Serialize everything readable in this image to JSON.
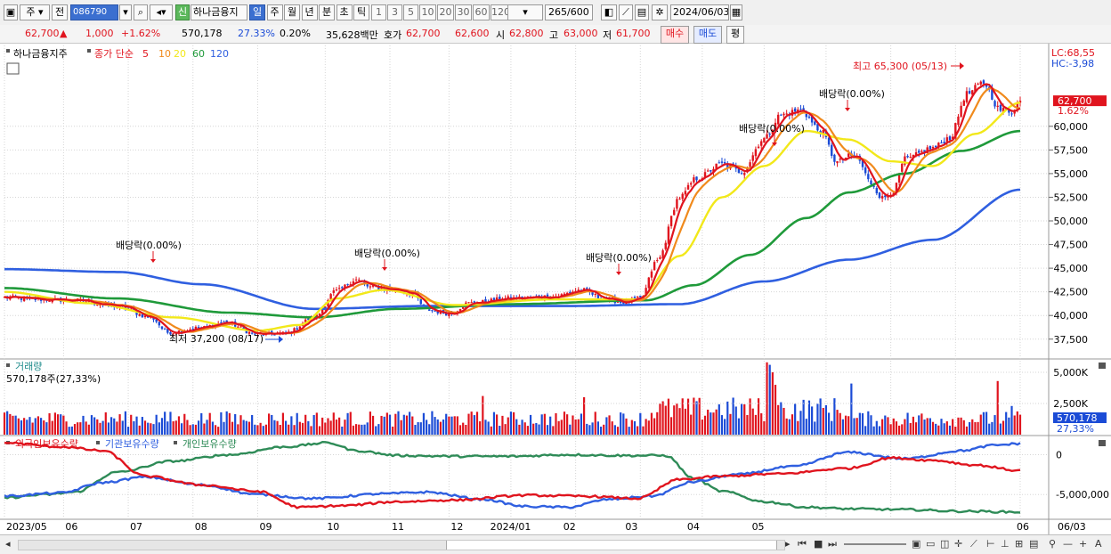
{
  "toolbar": {
    "period_mode": "주",
    "prev_label": "전",
    "code": "086790",
    "new_badge": "신",
    "stock_name": "하나금융지",
    "periods": [
      "일",
      "주",
      "월",
      "년",
      "분",
      "초",
      "틱"
    ],
    "selected_period": "일",
    "intervals": [
      "1",
      "3",
      "5",
      "10",
      "20",
      "30",
      "60",
      "120"
    ],
    "count": "265",
    "count_total": "/600",
    "date": "2024/06/03"
  },
  "quote": {
    "price": "62,700",
    "arrow": "▲",
    "change": "1,000",
    "change_pct": "+1.62%",
    "volume": "570,178",
    "volume_ratio": "27.33%",
    "turnover_pct": "0.20%",
    "amount": "35,628백만",
    "bid_label": "호가",
    "ask_price": "62,700",
    "bid_price": "62,600",
    "open_label": "시",
    "open": "62,800",
    "high_label": "고",
    "high": "63,000",
    "low_label": "저",
    "low": "61,700",
    "buy_label": "매수",
    "sell_label": "매도",
    "avg_label": "평"
  },
  "colors": {
    "up": "#e0141e",
    "down": "#1b4bd6",
    "ma5": "#e0141e",
    "ma10": "#f08a1c",
    "ma20": "#f2e81a",
    "ma60": "#1f9a3a",
    "ma120": "#2f5fe0",
    "foreign": "#e0141e",
    "institution": "#2f5fe0",
    "individual": "#2e8b57"
  },
  "chart_data": [
    {
      "type": "candlestick",
      "title": "하나금융지주",
      "legend": [
        "종가 단순",
        "5",
        "10",
        "20",
        "60",
        "120"
      ],
      "ylim": [
        35500,
        68550
      ],
      "y_ticks": [
        "62,700",
        "60,000",
        "57,500",
        "55,000",
        "52,500",
        "50,000",
        "47,500",
        "45,000",
        "42,500",
        "40,000",
        "37,500"
      ],
      "x_ticks": [
        "2023/05",
        "06",
        "07",
        "08",
        "09",
        "10",
        "11",
        "12",
        "2024/01",
        "02",
        "03",
        "04",
        "05",
        "06",
        "06/03"
      ],
      "lc": "LC:68,55",
      "hc": "HC:-3,98",
      "last_price": "62,700",
      "last_pct": "1.62%",
      "price_anchors": [
        [
          0,
          41900
        ],
        [
          12,
          41700
        ],
        [
          25,
          41600
        ],
        [
          40,
          41000
        ],
        [
          52,
          39800
        ],
        [
          58,
          38200
        ],
        [
          70,
          38700
        ],
        [
          78,
          39300
        ],
        [
          90,
          38000
        ],
        [
          100,
          38100
        ],
        [
          110,
          39800
        ],
        [
          118,
          42600
        ],
        [
          125,
          43800
        ],
        [
          130,
          43000
        ],
        [
          140,
          42700
        ],
        [
          145,
          42300
        ],
        [
          150,
          40600
        ],
        [
          158,
          40200
        ],
        [
          165,
          41300
        ],
        [
          180,
          41800
        ],
        [
          195,
          42000
        ],
        [
          205,
          42700
        ],
        [
          213,
          41800
        ],
        [
          220,
          41400
        ],
        [
          226,
          41800
        ],
        [
          232,
          45800
        ],
        [
          240,
          52500
        ],
        [
          246,
          54500
        ],
        [
          255,
          56000
        ],
        [
          262,
          55200
        ],
        [
          270,
          58700
        ],
        [
          276,
          61200
        ],
        [
          283,
          61700
        ],
        [
          290,
          59500
        ],
        [
          296,
          56200
        ],
        [
          300,
          56800
        ],
        [
          303,
          56600
        ],
        [
          308,
          54000
        ],
        [
          312,
          52400
        ],
        [
          316,
          53200
        ],
        [
          320,
          56500
        ],
        [
          330,
          57700
        ],
        [
          336,
          58800
        ],
        [
          342,
          63400
        ],
        [
          348,
          64600
        ],
        [
          354,
          61700
        ],
        [
          358,
          61600
        ],
        [
          361,
          62700
        ]
      ],
      "ma_anchors": {
        "ma20": [
          [
            0,
            42500
          ],
          [
            30,
            41300
          ],
          [
            60,
            39800
          ],
          [
            90,
            38400
          ],
          [
            105,
            39000
          ],
          [
            118,
            41800
          ],
          [
            135,
            42700
          ],
          [
            160,
            41100
          ],
          [
            195,
            41700
          ],
          [
            225,
            41700
          ],
          [
            240,
            46300
          ],
          [
            255,
            52500
          ],
          [
            270,
            55800
          ],
          [
            285,
            59500
          ],
          [
            300,
            58600
          ],
          [
            315,
            56300
          ],
          [
            330,
            55800
          ],
          [
            345,
            59200
          ],
          [
            361,
            62500
          ]
        ],
        "ma60": [
          [
            0,
            42900
          ],
          [
            40,
            41800
          ],
          [
            80,
            40300
          ],
          [
            110,
            39800
          ],
          [
            140,
            40700
          ],
          [
            180,
            41200
          ],
          [
            228,
            41600
          ],
          [
            245,
            43200
          ],
          [
            265,
            46400
          ],
          [
            285,
            50300
          ],
          [
            300,
            53000
          ],
          [
            320,
            55000
          ],
          [
            340,
            57400
          ],
          [
            361,
            59500
          ]
        ],
        "ma120": [
          [
            0,
            44900
          ],
          [
            40,
            44600
          ],
          [
            70,
            43300
          ],
          [
            110,
            40700
          ],
          [
            150,
            41000
          ],
          [
            200,
            41000
          ],
          [
            240,
            41200
          ],
          [
            270,
            43600
          ],
          [
            300,
            45900
          ],
          [
            330,
            48000
          ],
          [
            361,
            53300
          ]
        ]
      },
      "annotations": [
        {
          "text": "배당락(0.00%)",
          "type": "dividend"
        },
        {
          "text": "최저 37,200 (08/17)",
          "type": "low"
        },
        {
          "text": "배당락(0.00%)",
          "type": "dividend"
        },
        {
          "text": "배당락(0.00%)",
          "type": "dividend"
        },
        {
          "text": "배당락(0.00%)",
          "type": "dividend"
        },
        {
          "text": "배당락(0.00%)",
          "type": "dividend"
        },
        {
          "text": "최고 65,300 (05/13)",
          "type": "high"
        }
      ]
    },
    {
      "type": "bar",
      "title": "거래량",
      "current": "570,178주(27,33%)",
      "y_ticks": [
        "5,000K",
        "2,500K"
      ],
      "last_value": "570,178",
      "last_pct": "27,33%",
      "ylim": [
        0,
        6000000
      ],
      "baseline": 1400000,
      "spikes": [
        [
          170,
          3100000
        ],
        [
          206,
          3000000
        ],
        [
          271,
          5800000
        ],
        [
          272,
          5600000
        ],
        [
          273,
          5000000
        ],
        [
          274,
          4000000
        ],
        [
          301,
          4100000
        ],
        [
          353,
          4300000
        ],
        [
          358,
          2300000
        ]
      ]
    },
    {
      "type": "line",
      "series_labels": [
        "외국인보유수량",
        "기관보유수량",
        "개인보유수량"
      ],
      "y_ticks": [
        "0",
        "-5,000,000"
      ],
      "foreign": [
        [
          0,
          1500000
        ],
        [
          20,
          1000000
        ],
        [
          35,
          500000
        ],
        [
          50,
          -2700000
        ],
        [
          70,
          -3800000
        ],
        [
          90,
          -4600000
        ],
        [
          105,
          -6600000
        ],
        [
          120,
          -6400000
        ],
        [
          140,
          -5900000
        ],
        [
          160,
          -5700000
        ],
        [
          185,
          -5100000
        ],
        [
          205,
          -5200000
        ],
        [
          225,
          -5500000
        ],
        [
          240,
          -3100000
        ],
        [
          255,
          -2700000
        ],
        [
          275,
          -2400000
        ],
        [
          300,
          -1700000
        ],
        [
          315,
          -400000
        ],
        [
          330,
          -700000
        ],
        [
          345,
          -1300000
        ],
        [
          361,
          -2000000
        ]
      ],
      "institution": [
        [
          0,
          -5200000
        ],
        [
          20,
          -4800000
        ],
        [
          35,
          -3500000
        ],
        [
          50,
          -2800000
        ],
        [
          70,
          -3800000
        ],
        [
          90,
          -5000000
        ],
        [
          110,
          -5500000
        ],
        [
          135,
          -4900000
        ],
        [
          150,
          -4700000
        ],
        [
          170,
          -5600000
        ],
        [
          185,
          -6500000
        ],
        [
          200,
          -6600000
        ],
        [
          215,
          -5600000
        ],
        [
          230,
          -5200000
        ],
        [
          245,
          -3400000
        ],
        [
          260,
          -2500000
        ],
        [
          280,
          -1500000
        ],
        [
          300,
          300000
        ],
        [
          320,
          -500000
        ],
        [
          340,
          500000
        ],
        [
          352,
          1200000
        ],
        [
          361,
          1400000
        ]
      ],
      "individual": [
        [
          0,
          -5400000
        ],
        [
          15,
          -5000000
        ],
        [
          25,
          -4700000
        ],
        [
          40,
          -2200000
        ],
        [
          60,
          -800000
        ],
        [
          80,
          0
        ],
        [
          100,
          1000000
        ],
        [
          115,
          1500000
        ],
        [
          125,
          500000
        ],
        [
          140,
          -100000
        ],
        [
          160,
          -200000
        ],
        [
          180,
          -200000
        ],
        [
          200,
          0
        ],
        [
          220,
          -100000
        ],
        [
          235,
          -100000
        ],
        [
          245,
          -3000000
        ],
        [
          255,
          -4600000
        ],
        [
          270,
          -5900000
        ],
        [
          285,
          -6600000
        ],
        [
          300,
          -6800000
        ],
        [
          320,
          -6900000
        ],
        [
          340,
          -7100000
        ],
        [
          361,
          -7200000
        ]
      ]
    }
  ]
}
